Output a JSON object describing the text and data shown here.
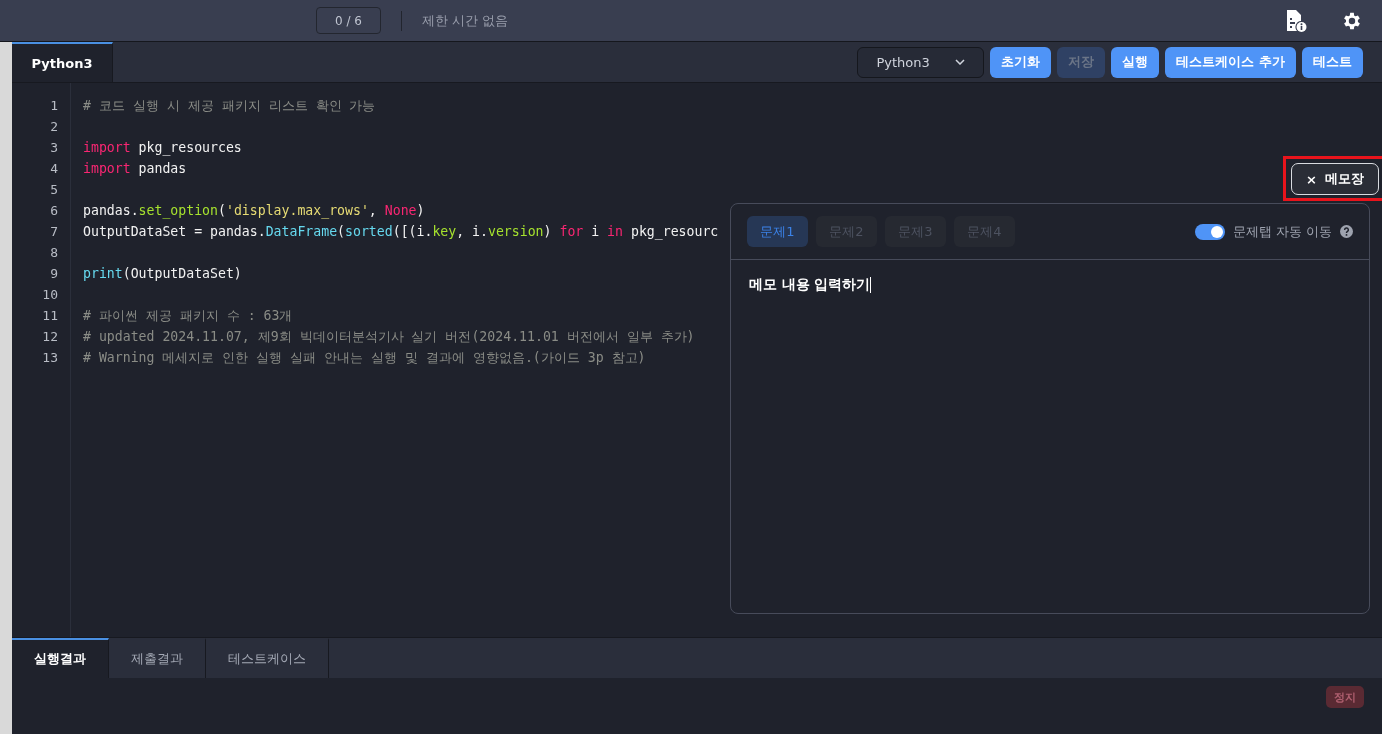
{
  "top_bar": {
    "progress": "0 / 6",
    "time_limit": "제한 시간 없음"
  },
  "editor_tabs": [
    {
      "label": "Python3",
      "selected": true
    }
  ],
  "toolbar": {
    "language": "Python3",
    "buttons": [
      {
        "label": "초기화",
        "disabled": false
      },
      {
        "label": "저장",
        "disabled": true
      },
      {
        "label": "실행",
        "disabled": false
      },
      {
        "label": "테스트케이스 추가",
        "disabled": false
      },
      {
        "label": "테스트",
        "disabled": false
      }
    ]
  },
  "code_lines": [
    {
      "number": "1",
      "tokens": [
        {
          "kind": "comment",
          "text": "# 코드 실행 시 제공 패키지 리스트 확인 가능"
        }
      ]
    },
    {
      "number": "2"
    },
    {
      "number": "3",
      "tokens": [
        {
          "kind": "keyword",
          "text": "import"
        },
        {
          "kind": "plain",
          "text": " pkg_resources"
        }
      ]
    },
    {
      "number": "4",
      "tokens": [
        {
          "kind": "keyword",
          "text": "import"
        },
        {
          "kind": "plain",
          "text": " pandas"
        }
      ]
    },
    {
      "number": "5"
    },
    {
      "number": "6",
      "tokens": [
        {
          "kind": "plain",
          "text": "pandas."
        },
        {
          "kind": "attr",
          "text": "set_option"
        },
        {
          "kind": "plain",
          "text": "("
        },
        {
          "kind": "string",
          "text": "'display.max_rows'"
        },
        {
          "kind": "plain",
          "text": ", "
        },
        {
          "kind": "keyword",
          "text": "None"
        },
        {
          "kind": "plain",
          "text": ")"
        }
      ]
    },
    {
      "number": "7",
      "tokens": [
        {
          "kind": "plain",
          "text": "OutputDataSet = pandas."
        },
        {
          "kind": "func",
          "text": "DataFrame"
        },
        {
          "kind": "plain",
          "text": "("
        },
        {
          "kind": "func",
          "text": "sorted"
        },
        {
          "kind": "plain",
          "text": "([(i."
        },
        {
          "kind": "attr",
          "text": "key"
        },
        {
          "kind": "plain",
          "text": ", i."
        },
        {
          "kind": "attr",
          "text": "version"
        },
        {
          "kind": "plain",
          "text": ") "
        },
        {
          "kind": "keyword",
          "text": "for"
        },
        {
          "kind": "plain",
          "text": " i "
        },
        {
          "kind": "keyword",
          "text": "in"
        },
        {
          "kind": "plain",
          "text": " pkg_resourc"
        }
      ]
    },
    {
      "number": "8"
    },
    {
      "number": "9",
      "tokens": [
        {
          "kind": "func",
          "text": "print"
        },
        {
          "kind": "plain",
          "text": "(OutputDataSet)"
        }
      ]
    },
    {
      "number": "10"
    },
    {
      "number": "11",
      "tokens": [
        {
          "kind": "comment",
          "text": "# 파이썬 제공 패키지 수 : 63개"
        }
      ]
    },
    {
      "number": "12",
      "tokens": [
        {
          "kind": "comment",
          "text": "# updated 2024.11.07, 제9회 빅데이터분석기사 실기 버전(2024.11.01 버전에서 일부 추가)"
        }
      ]
    },
    {
      "number": "13",
      "tokens": [
        {
          "kind": "comment",
          "text": "# Warning 메세지로 인한 실행 실패 안내는 실행 및 결과에 영향없음.(가이드 3p 참고)"
        }
      ]
    }
  ],
  "memo_button": {
    "icon": "×",
    "label": "메모장"
  },
  "memo": {
    "tabs": [
      {
        "label": "문제1",
        "selected": true
      },
      {
        "label": "문제2",
        "selected": false
      },
      {
        "label": "문제3",
        "selected": false
      },
      {
        "label": "문제4",
        "selected": false
      }
    ],
    "auto_switch": {
      "label": "문제탭 자동 이동",
      "on": true
    },
    "value": "메모 내용 입력하기"
  },
  "result_tabs": [
    {
      "label": "실행결과",
      "selected": true
    },
    {
      "label": "제출결과",
      "selected": false
    },
    {
      "label": "테스트케이스",
      "selected": false
    }
  ],
  "stop_button": {
    "label": "정지",
    "disabled": true
  }
}
